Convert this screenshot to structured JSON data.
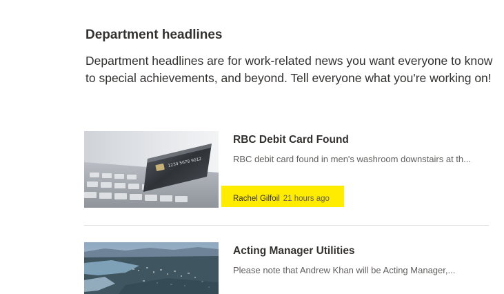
{
  "section": {
    "title": "Department headlines",
    "description_lines": [
      "Department headlines are for work-related news you want everyone to know",
      "to special achievements, and beyond. Tell everyone what you're working on!"
    ]
  },
  "news": [
    {
      "title": "RBC Debit Card Found",
      "description": "RBC debit card found in men's washroom downstairs at th...",
      "author": "Rachel Gilfoil",
      "time": "21 hours ago",
      "thumbnail_icon": "debit-card-on-keyboard-image"
    },
    {
      "title": "Acting Manager Utilities",
      "description": "Please note that Andrew Khan will be Acting Manager,...",
      "thumbnail_icon": "city-aerial-view-image"
    }
  ],
  "colors": {
    "highlight": "#ffec00",
    "title_text": "#323130",
    "secondary_text": "#605e5c",
    "divider": "#e1dfdd"
  }
}
